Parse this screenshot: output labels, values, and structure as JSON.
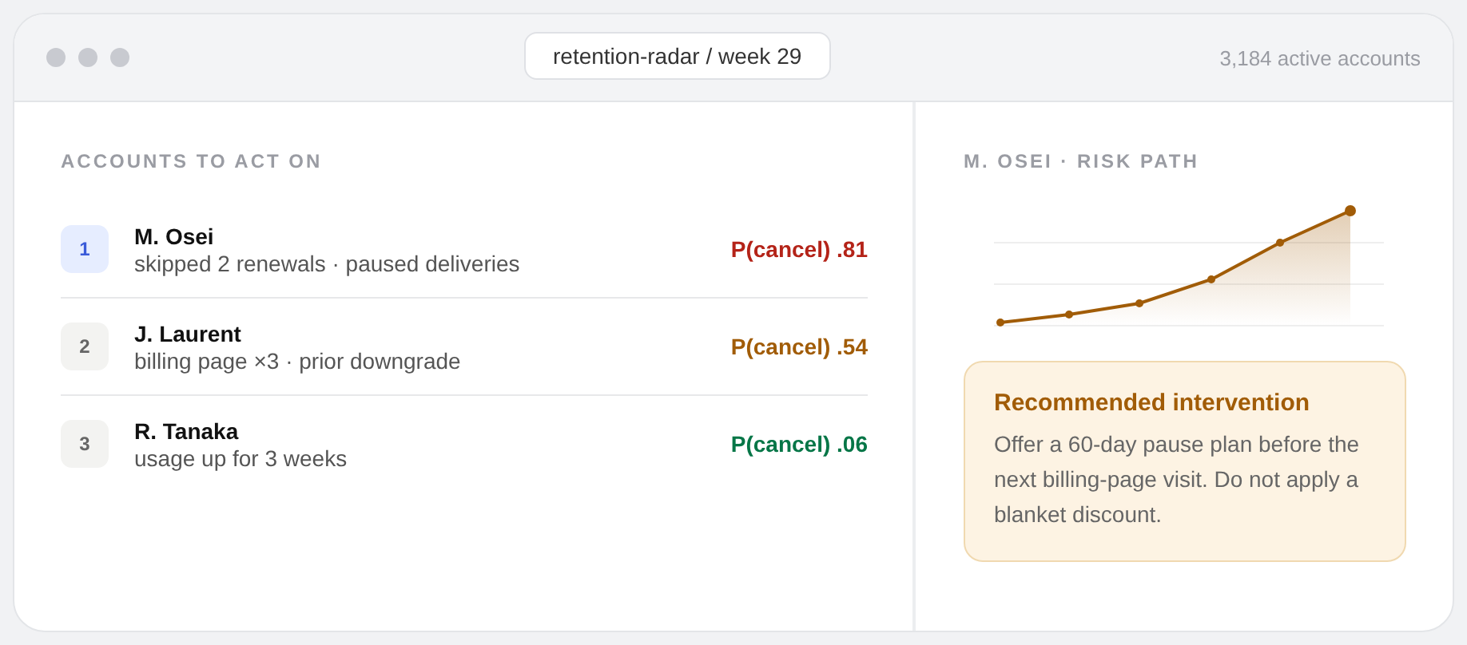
{
  "window": {
    "title": "retention-radar / week 29",
    "status": "3,184 active accounts"
  },
  "accounts": {
    "heading": "ACCOUNTS TO ACT ON",
    "rows": [
      {
        "rank": "1",
        "name": "M. Osei",
        "reason": "skipped 2 renewals · paused deliveries",
        "score": "P(cancel) .81",
        "color": "#b42318",
        "selected": true
      },
      {
        "rank": "2",
        "name": "J. Laurent",
        "reason": "billing page ×3 · prior downgrade",
        "score": "P(cancel) .54",
        "color": "#a15c07",
        "selected": false
      },
      {
        "rank": "3",
        "name": "R. Tanaka",
        "reason": "usage up for 3 weeks",
        "score": "P(cancel) .06",
        "color": "#067647",
        "selected": false
      }
    ]
  },
  "detail": {
    "heading": "M. OSEI · RISK PATH",
    "callout": {
      "title": "Recommended intervention",
      "body": "Offer a 60-day pause plan before the next billing-page visit. Do not apply a blanket discount."
    }
  }
}
